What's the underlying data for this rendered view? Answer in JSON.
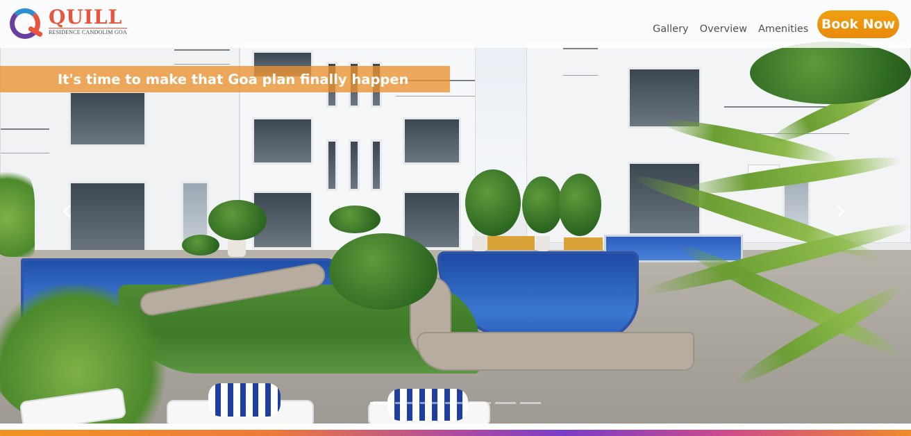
{
  "brand": {
    "name": "QUILL",
    "tagline": "RESIDENCE CANDOLIM GOA",
    "logo_icon": "quill-q-logo-icon",
    "colors": {
      "primary": "#e8543c",
      "secondary": "#6b3fa0",
      "accent": "#2d8fcf"
    }
  },
  "nav": {
    "items": [
      {
        "label": "Gallery"
      },
      {
        "label": "Overview"
      },
      {
        "label": "Amenities"
      }
    ],
    "cta_label": "Book Now",
    "cta_color": "#ee940f"
  },
  "slider": {
    "caption": "It's time to make that Goa plan finally happen",
    "caption_color": "#ec922e",
    "prev_icon": "chevron-left-icon",
    "next_icon": "chevron-right-icon",
    "slide_count": 7,
    "active_index": 0
  },
  "accent_bar_colors": [
    "#f29323",
    "#7a3cc8",
    "#f08a2a"
  ]
}
